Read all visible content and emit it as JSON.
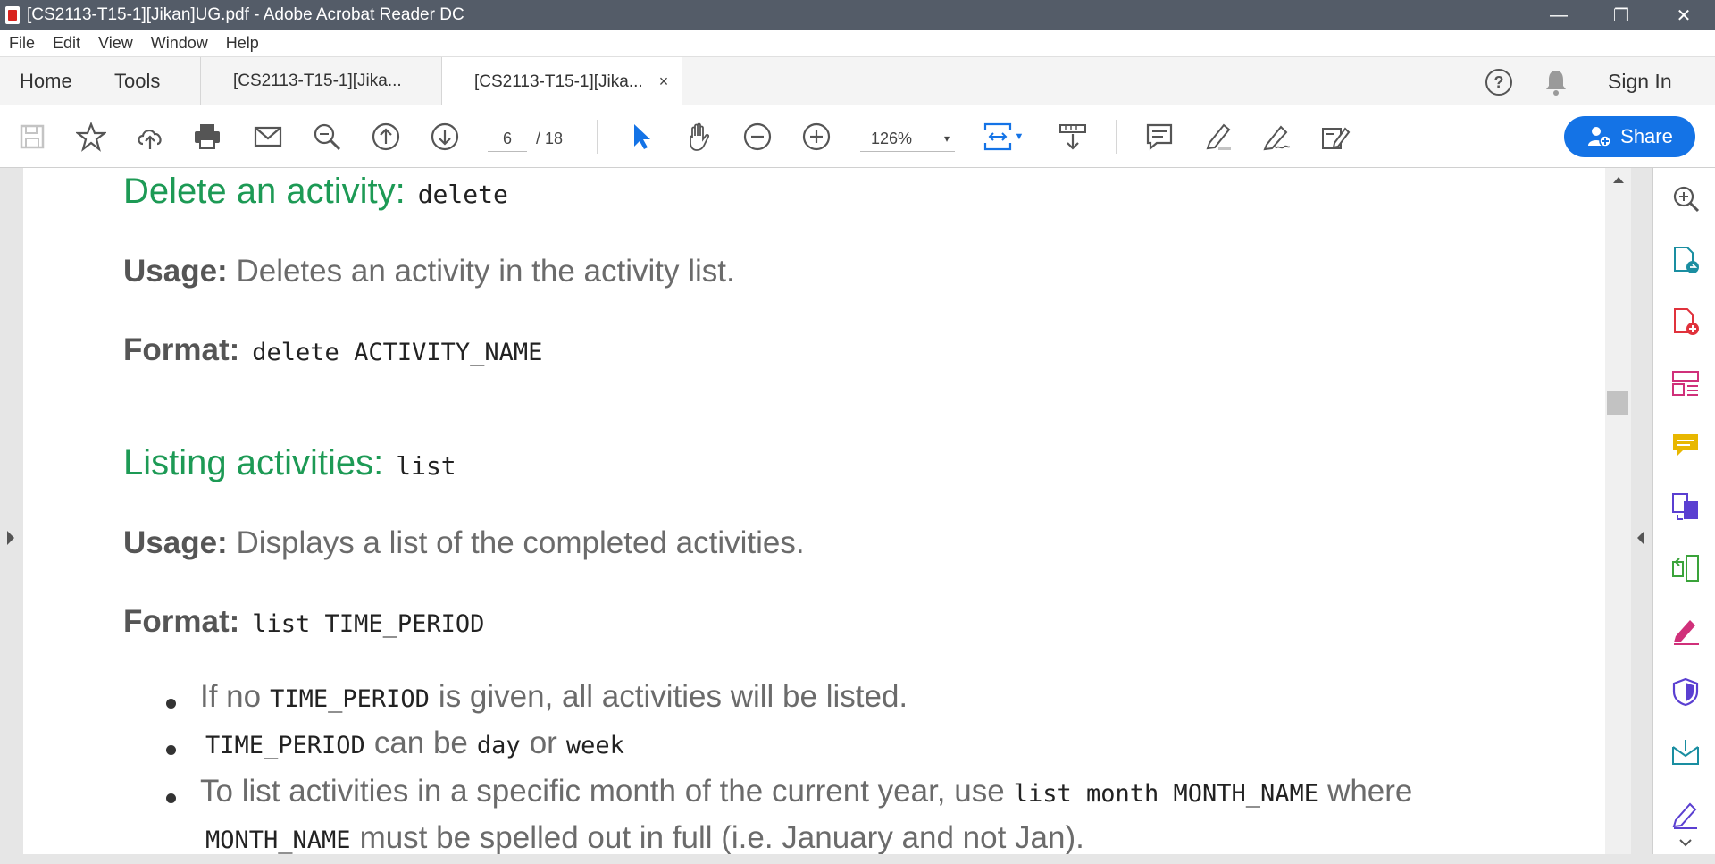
{
  "window": {
    "title": "[CS2113-T15-1][Jikan]UG.pdf - Adobe Acrobat Reader DC",
    "controls": [
      "—",
      "❐",
      "✕"
    ]
  },
  "menu": [
    "File",
    "Edit",
    "View",
    "Window",
    "Help"
  ],
  "tabs": {
    "home": "Home",
    "tools": "Tools",
    "doc1": "[CS2113-T15-1][Jika...",
    "doc2": "[CS2113-T15-1][Jika...",
    "close": "×",
    "signin": "Sign In",
    "help": "?"
  },
  "toolbar": {
    "page_current": "6",
    "page_total": "/ 18",
    "zoom": "126%",
    "zoom_caret": "▾",
    "share": "Share"
  },
  "document": {
    "h_delete": "Delete an activity:",
    "h_delete_cmd": "delete",
    "usage_label": "Usage:",
    "usage_delete": "Deletes an activity in the activity list.",
    "format_label": "Format:",
    "format_delete": "delete ACTIVITY_NAME",
    "h_list": "Listing activities:",
    "h_list_cmd": "list",
    "usage_list": "Displays a list of the completed activities.",
    "format_list": "list TIME_PERIOD",
    "b1_a": "If no",
    "b1_code": "TIME_PERIOD",
    "b1_b": "is given, all activities will be listed.",
    "b2_code1": "TIME_PERIOD",
    "b2_a": "can be",
    "b2_code2": "day",
    "b2_b": "or",
    "b2_code3": "week",
    "b3_a": "To list activities in a specific month of the current year, use",
    "b3_code": "list month MONTH_NAME",
    "b3_b": "where",
    "b4_code": "MONTH_NAME",
    "b4_a": "must be spelled out in full (i.e. January and not Jan)."
  },
  "colors": {
    "heading_green": "#1d9a55",
    "share_blue": "#1473e6",
    "titlebar": "#545c68"
  }
}
